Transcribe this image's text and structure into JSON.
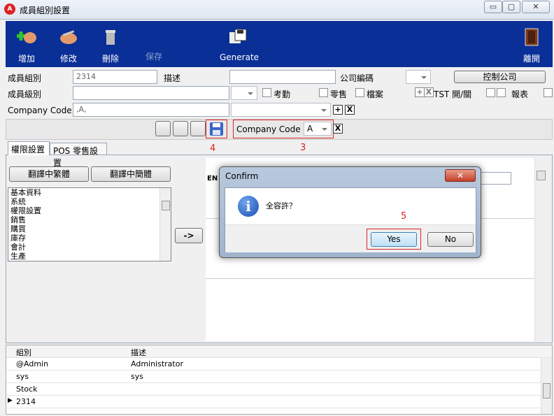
{
  "window": {
    "title": "成員組別設置",
    "app_icon": "A",
    "minimize": "▭",
    "restore": "▢",
    "close": "✕"
  },
  "toolbar": {
    "add": "增加",
    "edit": "修改",
    "delete": "刪除",
    "save": "保存",
    "generate": "Generate",
    "exit": "離開"
  },
  "form": {
    "group_label": "成員組別",
    "group_value": "2314",
    "desc_label": "描述",
    "desc_value": "",
    "company_no_label": "公司編碼",
    "control_company_button": "控制公司",
    "level_label": "成員級別",
    "attendance_label": "考勤",
    "retail_label": "零售",
    "file_label": "檔案",
    "tst_label": "TST 開/關",
    "report_label": "報表",
    "company_code_label": "Company Code :",
    "company_code_value": ",A,",
    "plus": "+",
    "x": "X"
  },
  "subtoolbar": {
    "company_code_label": "Company Code :",
    "company_code_value": "A",
    "clear": "X"
  },
  "annotations": {
    "a4": "4",
    "a3": "3",
    "a5": "5"
  },
  "tabs": [
    {
      "label": "權限設置"
    },
    {
      "label": "POS 零售設置"
    }
  ],
  "translate": {
    "traditional": "翻譯中繁體",
    "simplified": "翻譯中簡體"
  },
  "modules": [
    "基本資料",
    "系統",
    "權限設置",
    "銷售",
    "購買",
    "庫存",
    "會計",
    "生產"
  ],
  "move_button": "->",
  "right_panel": {
    "en_label": "EN"
  },
  "grid": {
    "headers": [
      "組別",
      "描述"
    ],
    "rows": [
      {
        "group": "@Admin",
        "desc": "Administrator"
      },
      {
        "group": "sys",
        "desc": "sys"
      },
      {
        "group": "Stock",
        "desc": ""
      },
      {
        "group": "2314",
        "desc": ""
      }
    ]
  },
  "dialog": {
    "title": "Confirm",
    "message": "全容許？",
    "yes": "Yes",
    "no": "No",
    "close": "✕"
  }
}
